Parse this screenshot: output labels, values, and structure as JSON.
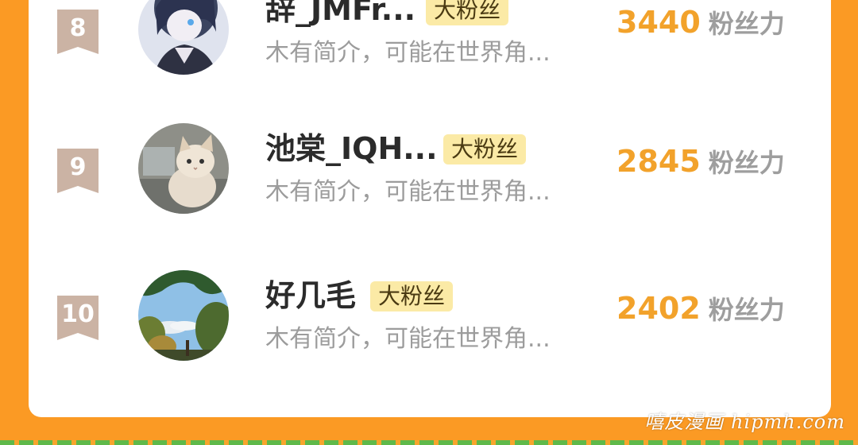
{
  "colors": {
    "page_background": "#fb9a24",
    "card_background": "#ffffff",
    "rank_badge": "#cbb3a4",
    "fan_tag_background": "#fbeaa6",
    "score_value": "#f2a22b",
    "score_unit": "#9e9e9e",
    "bio_text": "#9c9c9c"
  },
  "ranking": [
    {
      "rank": "8",
      "name": "辞_JMFr...",
      "tag": "大粉丝",
      "bio": "木有简介，可能在世界角...",
      "score": "3440",
      "score_unit": "粉丝力",
      "avatar_icon": "anime-character-avatar"
    },
    {
      "rank": "9",
      "name": "池棠_IQH...",
      "tag": "大粉丝",
      "bio": "木有简介，可能在世界角...",
      "score": "2845",
      "score_unit": "粉丝力",
      "avatar_icon": "kitten-photo-avatar"
    },
    {
      "rank": "10",
      "name": "好几毛",
      "tag": "大粉丝",
      "bio": "木有简介，可能在世界角...",
      "score": "2402",
      "score_unit": "粉丝力",
      "avatar_icon": "trees-sky-photo-avatar"
    }
  ],
  "watermark": "嘻皮漫画 hipmh.com"
}
